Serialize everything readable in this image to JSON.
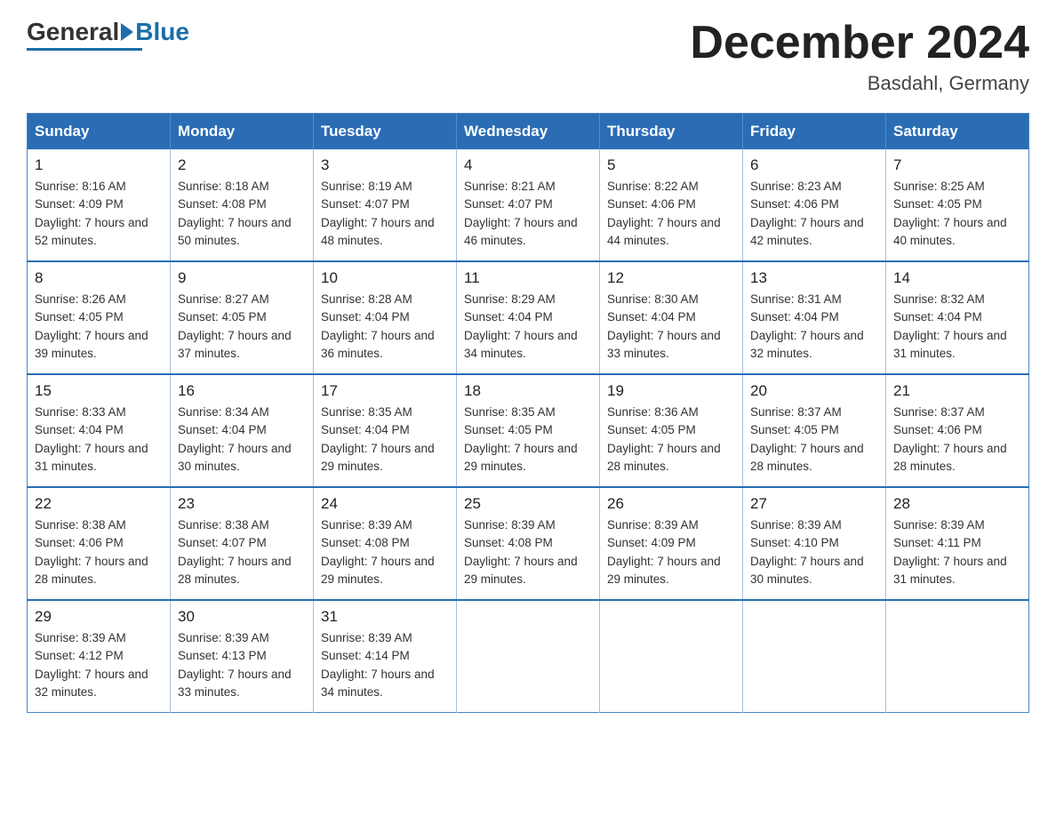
{
  "header": {
    "logo_general": "General",
    "logo_blue": "Blue",
    "month_title": "December 2024",
    "location": "Basdahl, Germany"
  },
  "weekdays": [
    "Sunday",
    "Monday",
    "Tuesday",
    "Wednesday",
    "Thursday",
    "Friday",
    "Saturday"
  ],
  "weeks": [
    [
      {
        "day": "1",
        "sunrise": "8:16 AM",
        "sunset": "4:09 PM",
        "daylight": "7 hours and 52 minutes."
      },
      {
        "day": "2",
        "sunrise": "8:18 AM",
        "sunset": "4:08 PM",
        "daylight": "7 hours and 50 minutes."
      },
      {
        "day": "3",
        "sunrise": "8:19 AM",
        "sunset": "4:07 PM",
        "daylight": "7 hours and 48 minutes."
      },
      {
        "day": "4",
        "sunrise": "8:21 AM",
        "sunset": "4:07 PM",
        "daylight": "7 hours and 46 minutes."
      },
      {
        "day": "5",
        "sunrise": "8:22 AM",
        "sunset": "4:06 PM",
        "daylight": "7 hours and 44 minutes."
      },
      {
        "day": "6",
        "sunrise": "8:23 AM",
        "sunset": "4:06 PM",
        "daylight": "7 hours and 42 minutes."
      },
      {
        "day": "7",
        "sunrise": "8:25 AM",
        "sunset": "4:05 PM",
        "daylight": "7 hours and 40 minutes."
      }
    ],
    [
      {
        "day": "8",
        "sunrise": "8:26 AM",
        "sunset": "4:05 PM",
        "daylight": "7 hours and 39 minutes."
      },
      {
        "day": "9",
        "sunrise": "8:27 AM",
        "sunset": "4:05 PM",
        "daylight": "7 hours and 37 minutes."
      },
      {
        "day": "10",
        "sunrise": "8:28 AM",
        "sunset": "4:04 PM",
        "daylight": "7 hours and 36 minutes."
      },
      {
        "day": "11",
        "sunrise": "8:29 AM",
        "sunset": "4:04 PM",
        "daylight": "7 hours and 34 minutes."
      },
      {
        "day": "12",
        "sunrise": "8:30 AM",
        "sunset": "4:04 PM",
        "daylight": "7 hours and 33 minutes."
      },
      {
        "day": "13",
        "sunrise": "8:31 AM",
        "sunset": "4:04 PM",
        "daylight": "7 hours and 32 minutes."
      },
      {
        "day": "14",
        "sunrise": "8:32 AM",
        "sunset": "4:04 PM",
        "daylight": "7 hours and 31 minutes."
      }
    ],
    [
      {
        "day": "15",
        "sunrise": "8:33 AM",
        "sunset": "4:04 PM",
        "daylight": "7 hours and 31 minutes."
      },
      {
        "day": "16",
        "sunrise": "8:34 AM",
        "sunset": "4:04 PM",
        "daylight": "7 hours and 30 minutes."
      },
      {
        "day": "17",
        "sunrise": "8:35 AM",
        "sunset": "4:04 PM",
        "daylight": "7 hours and 29 minutes."
      },
      {
        "day": "18",
        "sunrise": "8:35 AM",
        "sunset": "4:05 PM",
        "daylight": "7 hours and 29 minutes."
      },
      {
        "day": "19",
        "sunrise": "8:36 AM",
        "sunset": "4:05 PM",
        "daylight": "7 hours and 28 minutes."
      },
      {
        "day": "20",
        "sunrise": "8:37 AM",
        "sunset": "4:05 PM",
        "daylight": "7 hours and 28 minutes."
      },
      {
        "day": "21",
        "sunrise": "8:37 AM",
        "sunset": "4:06 PM",
        "daylight": "7 hours and 28 minutes."
      }
    ],
    [
      {
        "day": "22",
        "sunrise": "8:38 AM",
        "sunset": "4:06 PM",
        "daylight": "7 hours and 28 minutes."
      },
      {
        "day": "23",
        "sunrise": "8:38 AM",
        "sunset": "4:07 PM",
        "daylight": "7 hours and 28 minutes."
      },
      {
        "day": "24",
        "sunrise": "8:39 AM",
        "sunset": "4:08 PM",
        "daylight": "7 hours and 29 minutes."
      },
      {
        "day": "25",
        "sunrise": "8:39 AM",
        "sunset": "4:08 PM",
        "daylight": "7 hours and 29 minutes."
      },
      {
        "day": "26",
        "sunrise": "8:39 AM",
        "sunset": "4:09 PM",
        "daylight": "7 hours and 29 minutes."
      },
      {
        "day": "27",
        "sunrise": "8:39 AM",
        "sunset": "4:10 PM",
        "daylight": "7 hours and 30 minutes."
      },
      {
        "day": "28",
        "sunrise": "8:39 AM",
        "sunset": "4:11 PM",
        "daylight": "7 hours and 31 minutes."
      }
    ],
    [
      {
        "day": "29",
        "sunrise": "8:39 AM",
        "sunset": "4:12 PM",
        "daylight": "7 hours and 32 minutes."
      },
      {
        "day": "30",
        "sunrise": "8:39 AM",
        "sunset": "4:13 PM",
        "daylight": "7 hours and 33 minutes."
      },
      {
        "day": "31",
        "sunrise": "8:39 AM",
        "sunset": "4:14 PM",
        "daylight": "7 hours and 34 minutes."
      },
      null,
      null,
      null,
      null
    ]
  ]
}
